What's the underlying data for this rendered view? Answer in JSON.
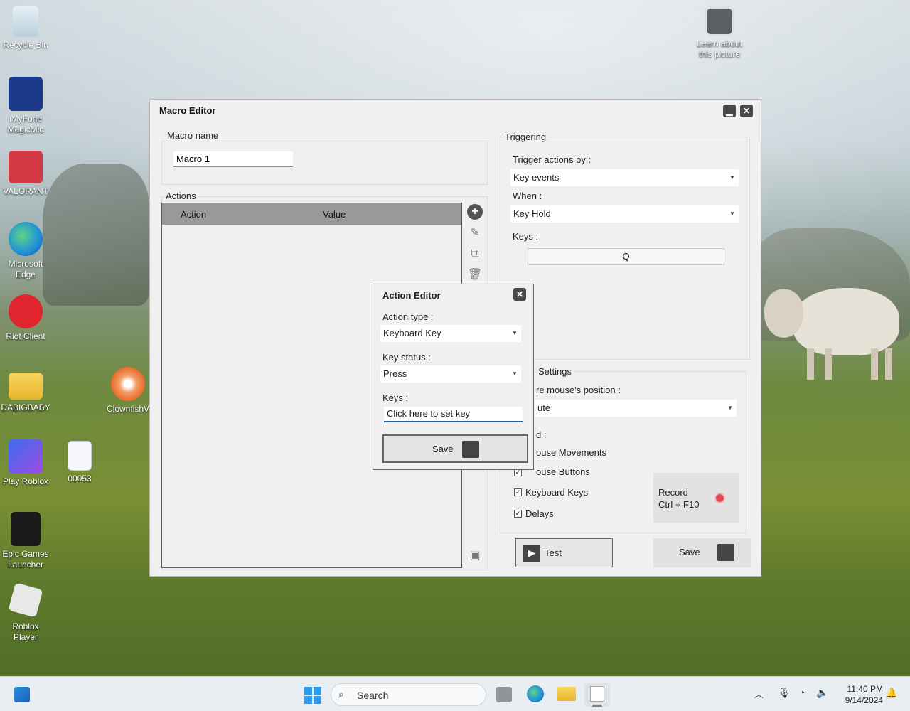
{
  "desktop": {
    "icons": [
      {
        "label": "Recycle Bin",
        "color": "#cfe2ee"
      },
      {
        "label": "iMyFone MagicMic",
        "color": "#1d3a8a"
      },
      {
        "label": "VALORANT",
        "color": "#d13a45"
      },
      {
        "label": "Microsoft Edge",
        "color": "#1f8fd8"
      },
      {
        "label": "Riot Client",
        "color": "#e0252f"
      },
      {
        "label": "DABIGBABY",
        "color": "#f0c23a"
      },
      {
        "label": "Play Roblox",
        "color": "#6b56d8"
      },
      {
        "label": "Epic Games Launcher",
        "color": "#1a1a1a"
      },
      {
        "label": "Roblox Player",
        "color": "#e8e8e8"
      },
      {
        "label": "ClownfishV",
        "color": "#f08a3a"
      },
      {
        "label": "00053",
        "color": "#2a7fd4"
      }
    ],
    "learn": {
      "line1": "Learn about",
      "line2": "this picture"
    }
  },
  "window": {
    "title": "Macro Editor",
    "minimize_glyph": "▁",
    "close_glyph": "✕",
    "macro_name_label": "Macro name",
    "macro_name_value": "Macro 1",
    "actions_label": "Actions",
    "columns": {
      "action": "Action",
      "value": "Value"
    },
    "triggering": {
      "label": "Triggering",
      "trigger_by_label": "Trigger actions by :",
      "trigger_by_value": "Key events",
      "when_label": "When :",
      "when_value": "Key Hold",
      "keys_label": "Keys :",
      "keys_value": "Q"
    },
    "settings": {
      "label": "Settings",
      "mouse_pos_label": "re mouse's position :",
      "mouse_pos_value": "ute",
      "record_label": "d :",
      "options": [
        {
          "label": "ouse Movements",
          "checked": false
        },
        {
          "label": "ouse Buttons",
          "checked": true
        },
        {
          "label": "Keyboard Keys",
          "checked": true
        },
        {
          "label": "Delays",
          "checked": true
        }
      ],
      "record_btn_line1": "Record",
      "record_btn_line2": "Ctrl + F10"
    },
    "test_label": "Test",
    "save_label": "Save"
  },
  "dialog": {
    "title": "Action Editor",
    "close_glyph": "✕",
    "action_type_label": "Action type :",
    "action_type_value": "Keyboard Key",
    "key_status_label": "Key status :",
    "key_status_value": "Press",
    "keys_label": "Keys :",
    "keys_value": "Click here to set key",
    "save_label": "Save"
  },
  "taskbar": {
    "search_placeholder": "Search",
    "time": "11:40 PM",
    "date": "9/14/2024"
  }
}
